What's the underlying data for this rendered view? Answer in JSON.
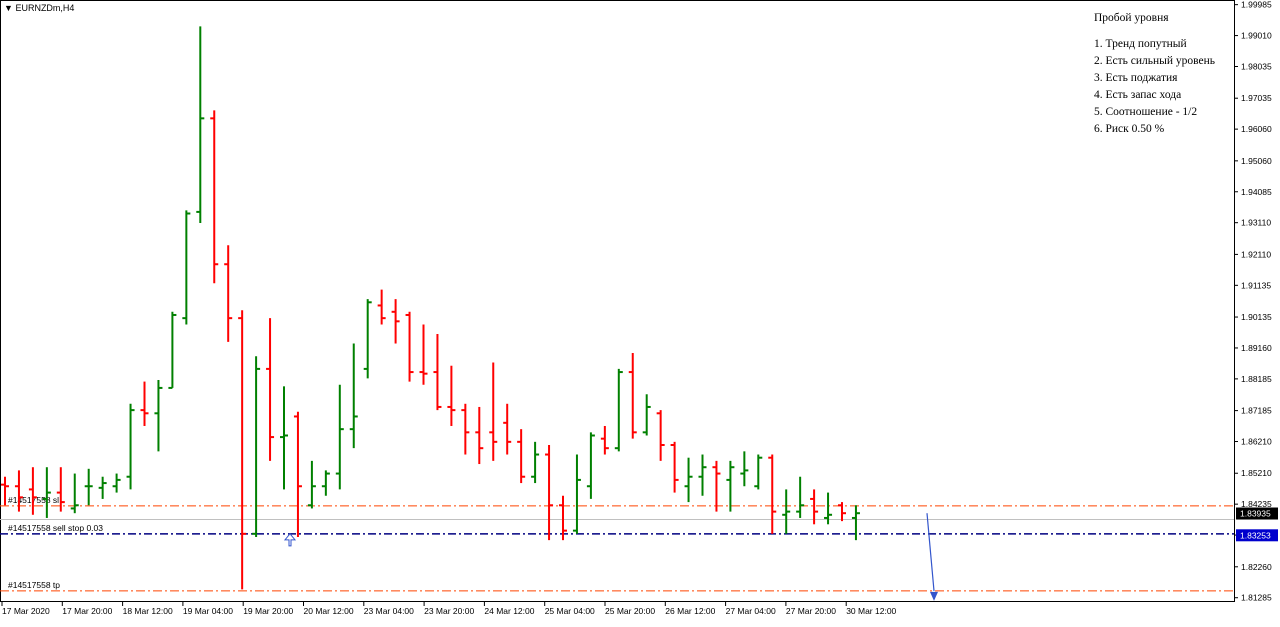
{
  "window": {
    "symbol_title": "EURNZDm,H4"
  },
  "strategy_box": {
    "title": "Пробой уровня",
    "rules": [
      "1. Тренд попутный",
      "2. Есть сильный уровень",
      "3. Есть поджатия",
      "4. Есть запас хода",
      "5. Соотношение - 1/2",
      "6. Риск 0.50 %"
    ]
  },
  "colors": {
    "bull": "#008000",
    "bear": "#ff0000",
    "order_line": "#000080",
    "sl_tp_line": "#ff4500",
    "bid_line": "#c0c0c0",
    "price_tag_dark": "#000000",
    "price_tag_blue": "#0000cd",
    "arrow": "#3355cc"
  },
  "chart_data": {
    "type": "ohlc",
    "ylim": [
      1.8115,
      2.001
    ],
    "y_ticks": [
      "1.99985",
      "1.99010",
      "1.98035",
      "1.97035",
      "1.96060",
      "1.95060",
      "1.94085",
      "1.93110",
      "1.92110",
      "1.91135",
      "1.90135",
      "1.89160",
      "1.88185",
      "1.87185",
      "1.86210",
      "1.85210",
      "1.84235",
      "1.83260",
      "1.82260",
      "1.81285"
    ],
    "x_labels": [
      "17 Mar 2020",
      "17 Mar 20:00",
      "18 Mar 12:00",
      "19 Mar 04:00",
      "19 Mar 20:00",
      "20 Mar 12:00",
      "23 Mar 04:00",
      "23 Mar 20:00",
      "24 Mar 12:00",
      "25 Mar 04:00",
      "25 Mar 20:00",
      "26 Mar 12:00",
      "27 Mar 04:00",
      "27 Mar 20:00",
      "30 Mar 12:00"
    ],
    "bars": [
      {
        "o": 1.8485,
        "h": 1.851,
        "l": 1.842,
        "c": 1.848
      },
      {
        "o": 1.848,
        "h": 1.853,
        "l": 1.84,
        "c": 1.8445
      },
      {
        "o": 1.847,
        "h": 1.854,
        "l": 1.839,
        "c": 1.8445
      },
      {
        "o": 1.844,
        "h": 1.854,
        "l": 1.838,
        "c": 1.846
      },
      {
        "o": 1.846,
        "h": 1.854,
        "l": 1.84,
        "c": 1.843
      },
      {
        "o": 1.841,
        "h": 1.852,
        "l": 1.8395,
        "c": 1.842
      },
      {
        "o": 1.848,
        "h": 1.8535,
        "l": 1.842,
        "c": 1.848
      },
      {
        "o": 1.8475,
        "h": 1.851,
        "l": 1.844,
        "c": 1.849
      },
      {
        "o": 1.848,
        "h": 1.852,
        "l": 1.846,
        "c": 1.85
      },
      {
        "o": 1.851,
        "h": 1.874,
        "l": 1.847,
        "c": 1.872
      },
      {
        "o": 1.872,
        "h": 1.881,
        "l": 1.867,
        "c": 1.871
      },
      {
        "o": 1.871,
        "h": 1.8815,
        "l": 1.859,
        "c": 1.879
      },
      {
        "o": 1.879,
        "h": 1.903,
        "l": 1.879,
        "c": 1.902
      },
      {
        "o": 1.901,
        "h": 1.935,
        "l": 1.899,
        "c": 1.934
      },
      {
        "o": 1.9345,
        "h": 1.993,
        "l": 1.931,
        "c": 1.964
      },
      {
        "o": 1.964,
        "h": 1.9665,
        "l": 1.912,
        "c": 1.918
      },
      {
        "o": 1.918,
        "h": 1.924,
        "l": 1.8935,
        "c": 1.901
      },
      {
        "o": 1.901,
        "h": 1.9035,
        "l": 1.8155,
        "c": 1.833
      },
      {
        "o": 1.833,
        "h": 1.889,
        "l": 1.832,
        "c": 1.885
      },
      {
        "o": 1.885,
        "h": 1.901,
        "l": 1.856,
        "c": 1.8635
      },
      {
        "o": 1.8635,
        "h": 1.8795,
        "l": 1.847,
        "c": 1.864
      },
      {
        "o": 1.87,
        "h": 1.8715,
        "l": 1.832,
        "c": 1.848
      },
      {
        "o": 1.842,
        "h": 1.856,
        "l": 1.841,
        "c": 1.848
      },
      {
        "o": 1.848,
        "h": 1.853,
        "l": 1.845,
        "c": 1.852
      },
      {
        "o": 1.852,
        "h": 1.88,
        "l": 1.847,
        "c": 1.866
      },
      {
        "o": 1.866,
        "h": 1.893,
        "l": 1.86,
        "c": 1.87
      },
      {
        "o": 1.885,
        "h": 1.907,
        "l": 1.882,
        "c": 1.906
      },
      {
        "o": 1.905,
        "h": 1.91,
        "l": 1.899,
        "c": 1.901
      },
      {
        "o": 1.903,
        "h": 1.907,
        "l": 1.893,
        "c": 1.9
      },
      {
        "o": 1.902,
        "h": 1.903,
        "l": 1.881,
        "c": 1.884
      },
      {
        "o": 1.884,
        "h": 1.899,
        "l": 1.88,
        "c": 1.8835
      },
      {
        "o": 1.884,
        "h": 1.896,
        "l": 1.872,
        "c": 1.873
      },
      {
        "o": 1.873,
        "h": 1.886,
        "l": 1.867,
        "c": 1.872
      },
      {
        "o": 1.872,
        "h": 1.874,
        "l": 1.858,
        "c": 1.865
      },
      {
        "o": 1.865,
        "h": 1.873,
        "l": 1.855,
        "c": 1.86
      },
      {
        "o": 1.865,
        "h": 1.887,
        "l": 1.856,
        "c": 1.862
      },
      {
        "o": 1.868,
        "h": 1.874,
        "l": 1.858,
        "c": 1.862
      },
      {
        "o": 1.862,
        "h": 1.866,
        "l": 1.849,
        "c": 1.851
      },
      {
        "o": 1.851,
        "h": 1.862,
        "l": 1.849,
        "c": 1.858
      },
      {
        "o": 1.858,
        "h": 1.861,
        "l": 1.831,
        "c": 1.842
      },
      {
        "o": 1.842,
        "h": 1.845,
        "l": 1.831,
        "c": 1.834
      },
      {
        "o": 1.834,
        "h": 1.858,
        "l": 1.833,
        "c": 1.85
      },
      {
        "o": 1.848,
        "h": 1.865,
        "l": 1.844,
        "c": 1.864
      },
      {
        "o": 1.863,
        "h": 1.867,
        "l": 1.858,
        "c": 1.86
      },
      {
        "o": 1.86,
        "h": 1.885,
        "l": 1.859,
        "c": 1.884
      },
      {
        "o": 1.884,
        "h": 1.89,
        "l": 1.863,
        "c": 1.865
      },
      {
        "o": 1.865,
        "h": 1.877,
        "l": 1.864,
        "c": 1.873
      },
      {
        "o": 1.871,
        "h": 1.872,
        "l": 1.856,
        "c": 1.861
      },
      {
        "o": 1.861,
        "h": 1.862,
        "l": 1.846,
        "c": 1.85
      },
      {
        "o": 1.848,
        "h": 1.857,
        "l": 1.843,
        "c": 1.851
      },
      {
        "o": 1.851,
        "h": 1.858,
        "l": 1.845,
        "c": 1.854
      },
      {
        "o": 1.854,
        "h": 1.856,
        "l": 1.84,
        "c": 1.852
      },
      {
        "o": 1.85,
        "h": 1.856,
        "l": 1.84,
        "c": 1.854
      },
      {
        "o": 1.852,
        "h": 1.859,
        "l": 1.848,
        "c": 1.853
      },
      {
        "o": 1.848,
        "h": 1.858,
        "l": 1.847,
        "c": 1.857
      },
      {
        "o": 1.857,
        "h": 1.858,
        "l": 1.833,
        "c": 1.84
      },
      {
        "o": 1.839,
        "h": 1.847,
        "l": 1.833,
        "c": 1.84
      },
      {
        "o": 1.84,
        "h": 1.851,
        "l": 1.838,
        "c": 1.842
      },
      {
        "o": 1.844,
        "h": 1.847,
        "l": 1.836,
        "c": 1.84
      },
      {
        "o": 1.838,
        "h": 1.846,
        "l": 1.836,
        "c": 1.839
      },
      {
        "o": 1.842,
        "h": 1.843,
        "l": 1.837,
        "c": 1.8395
      },
      {
        "o": 1.838,
        "h": 1.842,
        "l": 1.831,
        "c": 1.8395
      }
    ],
    "levels": [
      {
        "label": "#14517558 sl",
        "price": 1.8418,
        "kind": "sl"
      },
      {
        "label": "#14517558 sell stop 0.03",
        "price": 1.833,
        "kind": "order"
      },
      {
        "label": "#14517558 tp",
        "price": 1.815,
        "kind": "tp"
      }
    ],
    "price_tags": [
      {
        "text": "1.83935",
        "price": 1.8394,
        "style": "dark"
      },
      {
        "text": "1.83253",
        "price": 1.83253,
        "style": "blue"
      }
    ]
  }
}
